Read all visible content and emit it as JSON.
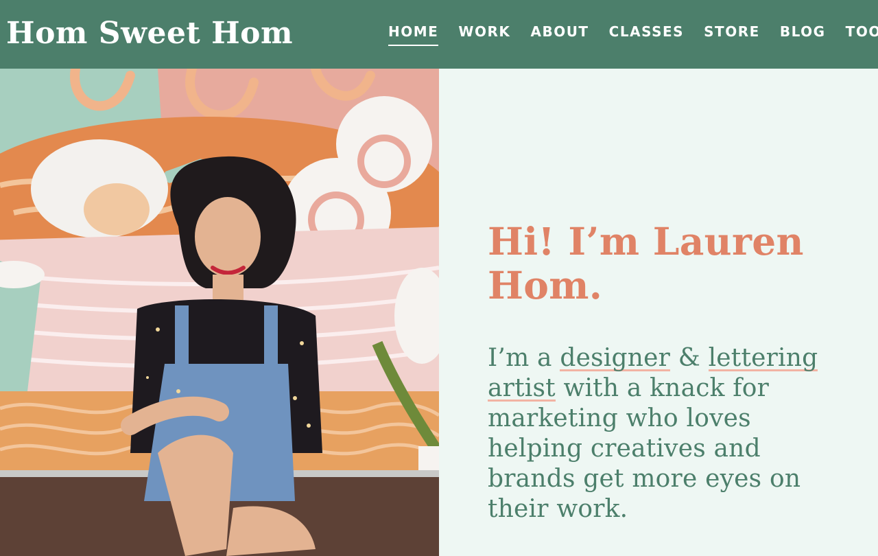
{
  "site": {
    "logo": "Hom Sweet Hom"
  },
  "nav": {
    "items": [
      {
        "label": "HOME",
        "active": true
      },
      {
        "label": "WORK"
      },
      {
        "label": "ABOUT"
      },
      {
        "label": "CLASSES"
      },
      {
        "label": "STORE"
      },
      {
        "label": "BLOG"
      },
      {
        "label": "TOOLBOX"
      }
    ]
  },
  "hero": {
    "headline": "Hi! I’m Lauren Hom.",
    "bio": {
      "part1": "I’m a ",
      "link1": "designer",
      "part2": " & ",
      "link2": "lettering artist",
      "part3": " with a knack for marketing who loves helping creatives and brands get more eyes on their work."
    }
  },
  "colors": {
    "header_bg": "#4c7f6b",
    "page_bg": "#eef7f3",
    "headline": "#e08366",
    "body_text": "#4c7f6b",
    "link_underline": "#f2b3a3"
  }
}
